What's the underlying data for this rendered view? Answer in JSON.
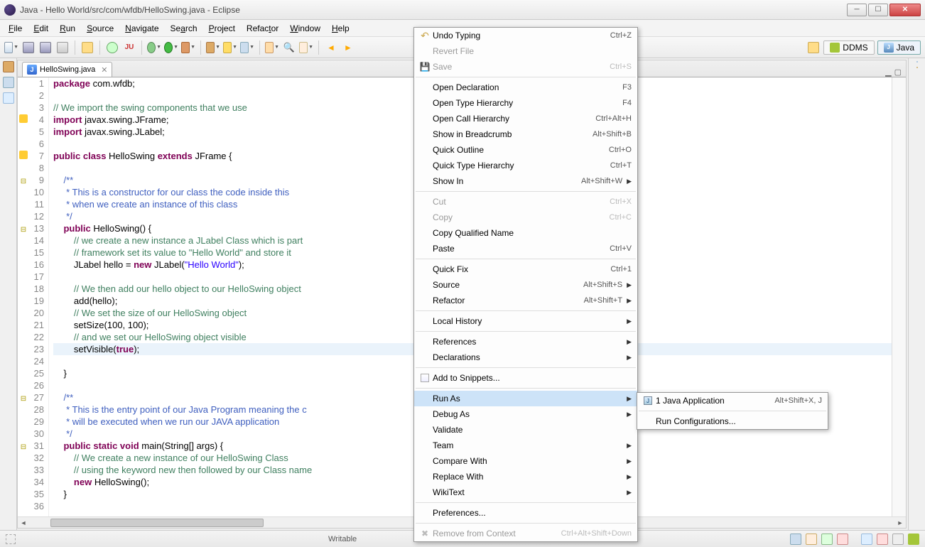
{
  "window": {
    "title": "Java - Hello World/src/com/wfdb/HelloSwing.java - Eclipse"
  },
  "menubar": [
    {
      "label": "File",
      "m": "F"
    },
    {
      "label": "Edit",
      "m": "E"
    },
    {
      "label": "Run",
      "m": "R"
    },
    {
      "label": "Source",
      "m": "S"
    },
    {
      "label": "Navigate",
      "m": "N"
    },
    {
      "label": "Search",
      "m": "a"
    },
    {
      "label": "Project",
      "m": "P"
    },
    {
      "label": "Refactor",
      "m": "t"
    },
    {
      "label": "Window",
      "m": "W"
    },
    {
      "label": "Help",
      "m": "H"
    }
  ],
  "perspectives": {
    "ddms": "DDMS",
    "java": "Java"
  },
  "tab": {
    "name": "HelloSwing.java"
  },
  "code": {
    "lines": [
      {
        "n": 1,
        "pre": "",
        "tokens": [
          {
            "t": "package ",
            "c": "kw"
          },
          {
            "t": "com.wfdb;"
          }
        ]
      },
      {
        "n": 2,
        "pre": "",
        "tokens": []
      },
      {
        "n": 3,
        "pre": "",
        "tokens": [
          {
            "t": "// We import the swing components that we use",
            "c": "cmt"
          }
        ]
      },
      {
        "n": 4,
        "pre": "",
        "ann": "warn",
        "tokens": [
          {
            "t": "import ",
            "c": "kw"
          },
          {
            "t": "javax.swing.JFrame;"
          }
        ]
      },
      {
        "n": 5,
        "pre": "",
        "tokens": [
          {
            "t": "import ",
            "c": "kw"
          },
          {
            "t": "javax.swing.JLabel;"
          }
        ]
      },
      {
        "n": 6,
        "pre": "",
        "tokens": []
      },
      {
        "n": 7,
        "pre": "",
        "ann": "warn",
        "tokens": [
          {
            "t": "public class ",
            "c": "kw"
          },
          {
            "t": "HelloSwing "
          },
          {
            "t": "extends ",
            "c": "kw"
          },
          {
            "t": "JFrame {"
          }
        ]
      },
      {
        "n": 8,
        "pre": "",
        "tokens": []
      },
      {
        "n": 9,
        "pre": "    ",
        "ann": "fold",
        "tokens": [
          {
            "t": "/**",
            "c": "jdoc"
          }
        ]
      },
      {
        "n": 10,
        "pre": "    ",
        "tokens": [
          {
            "t": " * This is a constructor for our class the code inside this",
            "c": "jdoc"
          }
        ]
      },
      {
        "n": 11,
        "pre": "    ",
        "tokens": [
          {
            "t": " * when we create an instance of this class",
            "c": "jdoc"
          }
        ]
      },
      {
        "n": 12,
        "pre": "    ",
        "tokens": [
          {
            "t": " */",
            "c": "jdoc"
          }
        ]
      },
      {
        "n": 13,
        "pre": "    ",
        "ann": "fold",
        "tokens": [
          {
            "t": "public ",
            "c": "kw"
          },
          {
            "t": "HelloSwing() {"
          }
        ]
      },
      {
        "n": 14,
        "pre": "        ",
        "tokens": [
          {
            "t": "// we create a new instance a JLabel Class which is part",
            "c": "cmt"
          }
        ]
      },
      {
        "n": 15,
        "pre": "        ",
        "tokens": [
          {
            "t": "// framework set its value to \"Hello World\" and store it",
            "c": "cmt"
          }
        ]
      },
      {
        "n": 16,
        "pre": "        ",
        "tokens": [
          {
            "t": "JLabel hello = "
          },
          {
            "t": "new ",
            "c": "kw"
          },
          {
            "t": "JLabel("
          },
          {
            "t": "\"Hello World\"",
            "c": "str"
          },
          {
            "t": ");"
          }
        ]
      },
      {
        "n": 17,
        "pre": "",
        "tokens": []
      },
      {
        "n": 18,
        "pre": "        ",
        "tokens": [
          {
            "t": "// We then add our hello object to our HelloSwing object",
            "c": "cmt"
          }
        ]
      },
      {
        "n": 19,
        "pre": "        ",
        "tokens": [
          {
            "t": "add(hello);"
          }
        ]
      },
      {
        "n": 20,
        "pre": "        ",
        "tokens": [
          {
            "t": "// We set the size of our HelloSwing object",
            "c": "cmt"
          }
        ]
      },
      {
        "n": 21,
        "pre": "        ",
        "tokens": [
          {
            "t": "setSize(100, 100);"
          }
        ]
      },
      {
        "n": 22,
        "pre": "        ",
        "tokens": [
          {
            "t": "// and we set our HelloSwing object visible",
            "c": "cmt"
          }
        ]
      },
      {
        "n": 23,
        "pre": "        ",
        "hl": true,
        "tokens": [
          {
            "t": "setVisible("
          },
          {
            "t": "true",
            "c": "kw"
          },
          {
            "t": ");"
          }
        ]
      },
      {
        "n": 24,
        "pre": "",
        "tokens": []
      },
      {
        "n": 25,
        "pre": "    ",
        "tokens": [
          {
            "t": "}"
          }
        ]
      },
      {
        "n": 26,
        "pre": "",
        "tokens": []
      },
      {
        "n": 27,
        "pre": "    ",
        "ann": "fold",
        "tokens": [
          {
            "t": "/**",
            "c": "jdoc"
          }
        ]
      },
      {
        "n": 28,
        "pre": "    ",
        "tokens": [
          {
            "t": " * This is the entry point of our Java Program meaning the c",
            "c": "jdoc"
          }
        ]
      },
      {
        "n": 29,
        "pre": "    ",
        "tokens": [
          {
            "t": " * will be executed when we run our JAVA application",
            "c": "jdoc"
          }
        ]
      },
      {
        "n": 30,
        "pre": "    ",
        "tokens": [
          {
            "t": " */",
            "c": "jdoc"
          }
        ]
      },
      {
        "n": 31,
        "pre": "    ",
        "ann": "fold",
        "tokens": [
          {
            "t": "public static void ",
            "c": "kw"
          },
          {
            "t": "main(String[] args) {"
          }
        ]
      },
      {
        "n": 32,
        "pre": "        ",
        "tokens": [
          {
            "t": "// We create a new instance of our HelloSwing Class",
            "c": "cmt"
          }
        ]
      },
      {
        "n": 33,
        "pre": "        ",
        "tokens": [
          {
            "t": "// using the keyword new then followed by our Class name",
            "c": "cmt"
          }
        ]
      },
      {
        "n": 34,
        "pre": "        ",
        "tokens": [
          {
            "t": "new ",
            "c": "kw"
          },
          {
            "t": "HelloSwing();"
          }
        ]
      },
      {
        "n": 35,
        "pre": "    ",
        "tokens": [
          {
            "t": "}"
          }
        ]
      },
      {
        "n": 36,
        "pre": "",
        "tokens": []
      }
    ]
  },
  "statusbar": {
    "writable": "Writable"
  },
  "context_menu": [
    {
      "icon": "undo",
      "label": "Undo Typing",
      "shortcut": "Ctrl+Z"
    },
    {
      "label": "Revert File",
      "disabled": true
    },
    {
      "icon": "save",
      "label": "Save",
      "shortcut": "Ctrl+S",
      "disabled": true
    },
    {
      "sep": true
    },
    {
      "label": "Open Declaration",
      "shortcut": "F3"
    },
    {
      "label": "Open Type Hierarchy",
      "shortcut": "F4"
    },
    {
      "label": "Open Call Hierarchy",
      "shortcut": "Ctrl+Alt+H"
    },
    {
      "label": "Show in Breadcrumb",
      "shortcut": "Alt+Shift+B"
    },
    {
      "label": "Quick Outline",
      "shortcut": "Ctrl+O"
    },
    {
      "label": "Quick Type Hierarchy",
      "shortcut": "Ctrl+T"
    },
    {
      "label": "Show In",
      "shortcut": "Alt+Shift+W",
      "submenu": true
    },
    {
      "sep": true
    },
    {
      "label": "Cut",
      "shortcut": "Ctrl+X",
      "disabled": true
    },
    {
      "label": "Copy",
      "shortcut": "Ctrl+C",
      "disabled": true
    },
    {
      "label": "Copy Qualified Name"
    },
    {
      "label": "Paste",
      "shortcut": "Ctrl+V"
    },
    {
      "sep": true
    },
    {
      "label": "Quick Fix",
      "shortcut": "Ctrl+1"
    },
    {
      "label": "Source",
      "shortcut": "Alt+Shift+S",
      "submenu": true
    },
    {
      "label": "Refactor",
      "shortcut": "Alt+Shift+T",
      "submenu": true
    },
    {
      "sep": true
    },
    {
      "label": "Local History",
      "submenu": true
    },
    {
      "sep": true
    },
    {
      "label": "References",
      "submenu": true
    },
    {
      "label": "Declarations",
      "submenu": true
    },
    {
      "sep": true
    },
    {
      "icon": "snippet",
      "label": "Add to Snippets..."
    },
    {
      "sep": true
    },
    {
      "label": "Run As",
      "submenu": true,
      "highlighted": true
    },
    {
      "label": "Debug As",
      "submenu": true
    },
    {
      "label": "Validate"
    },
    {
      "label": "Team",
      "submenu": true
    },
    {
      "label": "Compare With",
      "submenu": true
    },
    {
      "label": "Replace With",
      "submenu": true
    },
    {
      "label": "WikiText",
      "submenu": true
    },
    {
      "sep": true
    },
    {
      "label": "Preferences..."
    },
    {
      "sep": true
    },
    {
      "icon": "remove",
      "label": "Remove from Context",
      "shortcut": "Ctrl+Alt+Shift+Down",
      "disabled": true
    }
  ],
  "run_as_submenu": [
    {
      "icon": "java-run",
      "label": "1 Java Application",
      "shortcut": "Alt+Shift+X, J"
    },
    {
      "sep": true
    },
    {
      "label": "Run Configurations..."
    }
  ]
}
